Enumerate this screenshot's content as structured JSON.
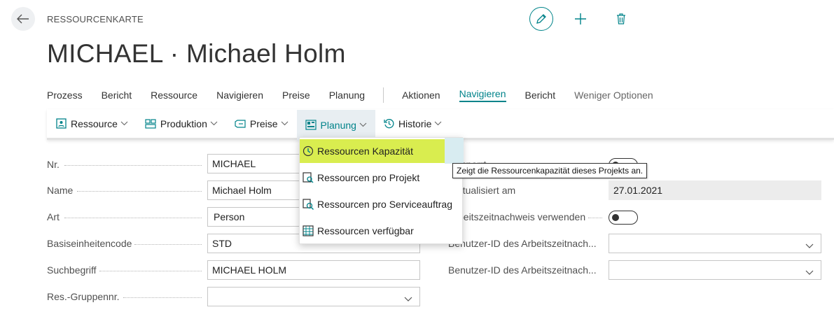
{
  "header": {
    "caption": "RESSOURCENKARTE",
    "title": "MICHAEL · Michael Holm"
  },
  "icons": {
    "back": "arrow-left-icon",
    "edit": "pencil-icon",
    "add": "plus-icon",
    "delete": "trash-icon"
  },
  "colors": {
    "accent": "#00838a",
    "highlight": "#d9ed4f",
    "readonly_bg": "#ececec"
  },
  "action_bar": {
    "left": [
      "Prozess",
      "Bericht",
      "Ressource",
      "Navigieren",
      "Preise",
      "Planung"
    ],
    "right": [
      "Aktionen",
      "Navigieren",
      "Bericht",
      "Weniger Optionen"
    ],
    "active_label": "Navigieren"
  },
  "subbar": {
    "items": [
      "Ressource",
      "Produktion",
      "Preise",
      "Planung",
      "Historie"
    ],
    "open_item": "Planung"
  },
  "dropdown": {
    "items": [
      "Ressourcen Kapazität",
      "Ressourcen pro Projekt",
      "Ressourcen pro Serviceauftrag",
      "Ressourcen verfügbar"
    ],
    "highlighted": "Ressourcen Kapazität"
  },
  "tooltip": "Zeigt die Ressourcenkapazität dieses Projekts an.",
  "fields_left": {
    "nr": {
      "label": "Nr.",
      "value": "MICHAEL"
    },
    "name": {
      "label": "Name",
      "value": "Michael Holm"
    },
    "art": {
      "label": "Art",
      "value": "Person"
    },
    "basiseinheit": {
      "label": "Basiseinheitencode",
      "value": "STD"
    },
    "suchbegriff": {
      "label": "Suchbegriff",
      "value": "MICHAEL HOLM"
    },
    "gruppe": {
      "label": "Res.-Gruppennr.",
      "value": ""
    }
  },
  "fields_right": {
    "gesperrt": {
      "label": "Gesperrt",
      "value": false
    },
    "aktualisiert": {
      "label": "Zuletzt aktualisiert am",
      "value": "27.01.2021"
    },
    "zeitnachweis": {
      "label": "Arbeitszeitnachweis verwenden",
      "value": false
    },
    "benutzer1": {
      "label": "Benutzer-ID des Arbeitszeitnach...",
      "value": ""
    },
    "benutzer2": {
      "label": "Benutzer-ID des Arbeitszeitnach...",
      "value": ""
    }
  }
}
